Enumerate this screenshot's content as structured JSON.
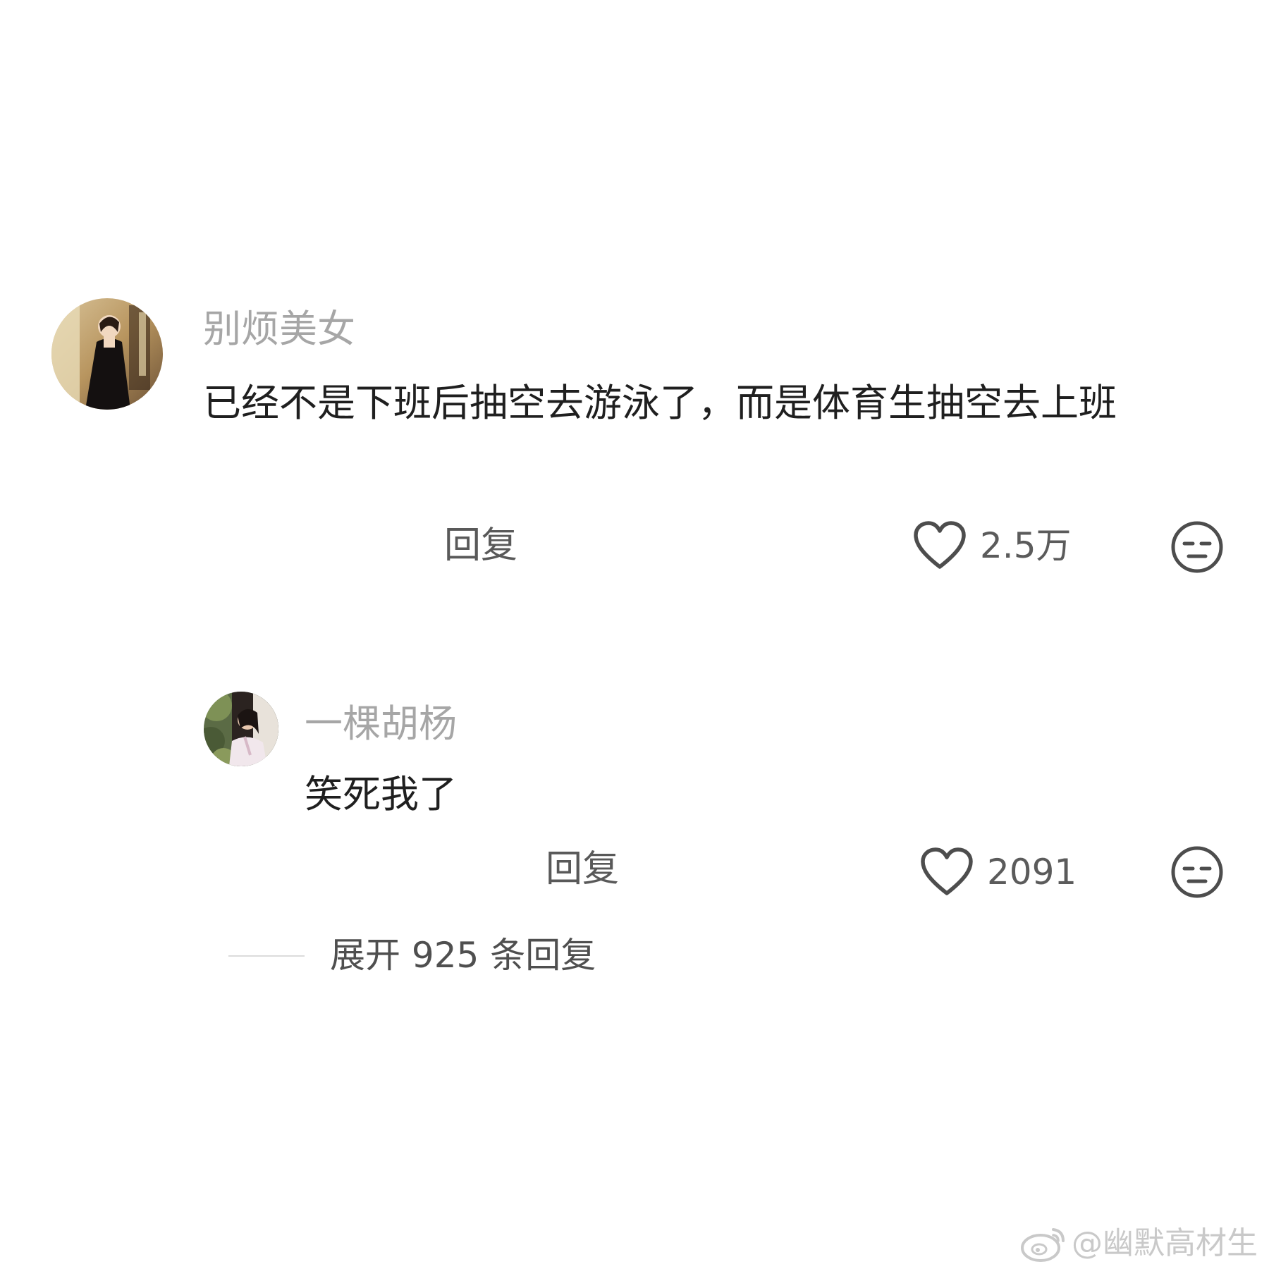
{
  "comments": [
    {
      "username": "别烦美女",
      "text": "已经不是下班后抽空去游泳了，而是体育生抽空去上班",
      "reply_label": "回复",
      "like_count": "2.5万",
      "avatar_icon": "user-avatar-photo",
      "like_icon": "heart-outline-icon",
      "dislike_icon": "meh-face-icon"
    },
    {
      "username": "一棵胡杨",
      "text": "笑死我了",
      "reply_label": "回复",
      "like_count": "2091",
      "avatar_icon": "user-avatar-photo",
      "like_icon": "heart-outline-icon",
      "dislike_icon": "meh-face-icon"
    }
  ],
  "expand_replies": {
    "label": "展开 925 条回复"
  },
  "watermark": {
    "text": "@幽默高材生",
    "icon": "weibo-logo-icon"
  }
}
